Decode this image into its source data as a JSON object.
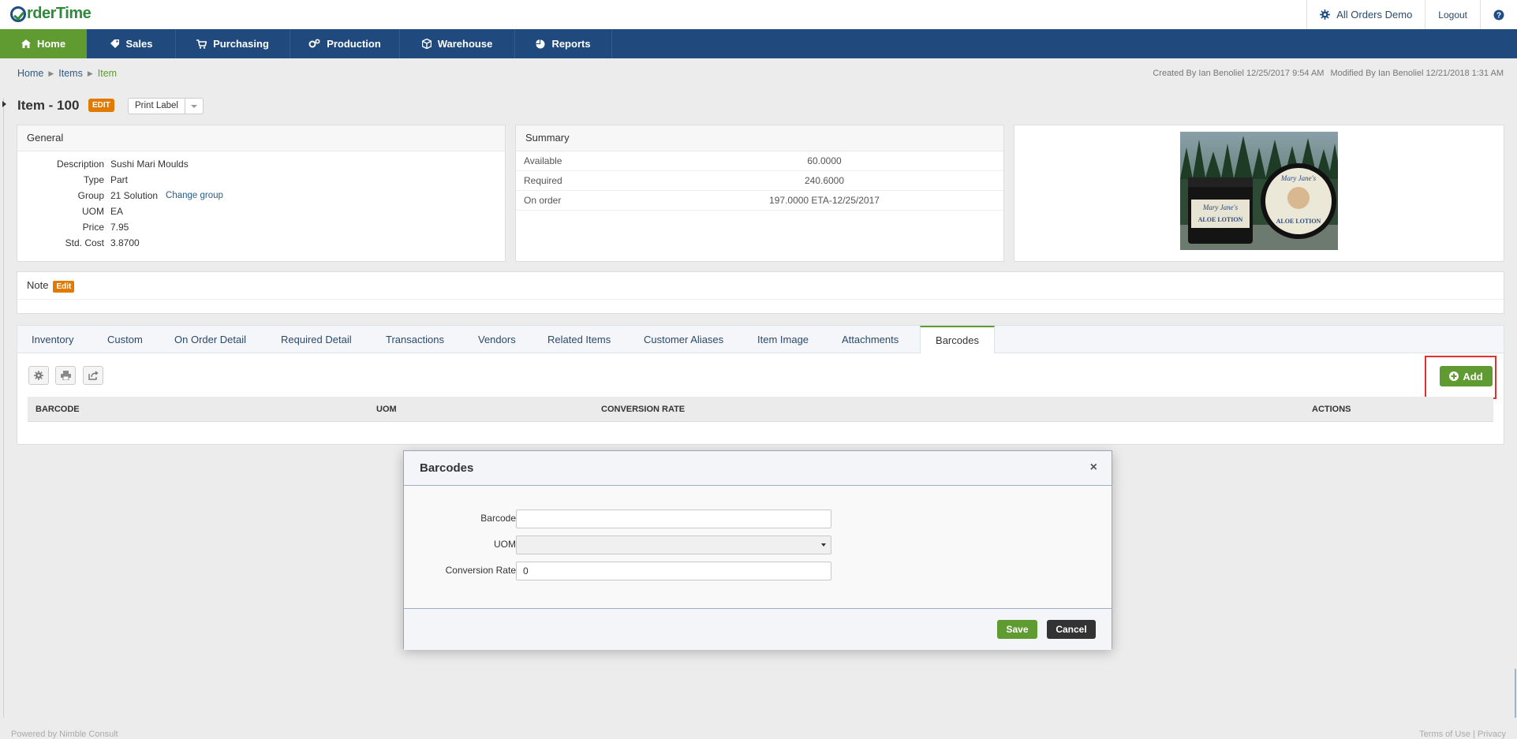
{
  "app": {
    "logo": "rderTime",
    "company": "All Orders Demo",
    "logout": "Logout",
    "help": "?"
  },
  "nav": [
    {
      "label": "Home",
      "icon": "home-icon"
    },
    {
      "label": "Sales",
      "icon": "tag-icon"
    },
    {
      "label": "Purchasing",
      "icon": "cart-icon"
    },
    {
      "label": "Production",
      "icon": "gears-icon"
    },
    {
      "label": "Warehouse",
      "icon": "cube-icon"
    },
    {
      "label": "Reports",
      "icon": "pie-chart-icon"
    }
  ],
  "breadcrumb": [
    "Home",
    "Items",
    "Item"
  ],
  "meta": {
    "created": "Created By Ian Benoliel 12/25/2017 9:54 AM",
    "modified": "Modified By Ian Benoliel 12/21/2018 1:31 AM"
  },
  "item": {
    "title": "Item - 100",
    "edit_badge": "EDIT",
    "print_label": "Print Label"
  },
  "general": {
    "heading": "General",
    "rows": [
      {
        "label": "Description",
        "value": "Sushi Mari Moulds"
      },
      {
        "label": "Type",
        "value": "Part"
      },
      {
        "label": "Group",
        "value": "21 Solution"
      },
      {
        "label": "UOM",
        "value": "EA"
      },
      {
        "label": "Price",
        "value": "7.95"
      },
      {
        "label": "Std. Cost",
        "value": "3.8700"
      }
    ],
    "change_group": "Change group"
  },
  "summary": {
    "heading": "Summary",
    "rows": [
      {
        "label": "Available",
        "value": "60.0000"
      },
      {
        "label": "Required",
        "value": "240.6000"
      },
      {
        "label": "On order",
        "value": "197.0000 ETA-12/25/2017"
      }
    ]
  },
  "image": {
    "label_left_brand": "Mary Jane's",
    "label_left_product": "ALOE LOTION",
    "label_right_brand": "Mary Jane's",
    "label_right_product": "ALOE LOTION"
  },
  "note": {
    "heading": "Note",
    "edit": "Edit"
  },
  "tabs": [
    "Inventory",
    "Custom",
    "On Order Detail",
    "Required Detail",
    "Transactions",
    "Vendors",
    "Related Items",
    "Customer Aliases",
    "Item Image",
    "Attachments",
    "Barcodes"
  ],
  "active_tab": "Barcodes",
  "grid": {
    "add": "Add",
    "columns": [
      "BARCODE",
      "UOM",
      "CONVERSION RATE",
      "ACTIONS"
    ]
  },
  "modal": {
    "title": "Barcodes",
    "close": "×",
    "fields": {
      "barcode_label": "Barcode",
      "barcode_value": "",
      "uom_label": "UOM",
      "uom_value": "",
      "rate_label": "Conversion Rate",
      "rate_value": "0"
    },
    "save": "Save",
    "cancel": "Cancel"
  },
  "footer": {
    "left": "Powered by Nimble Consult",
    "right": "Terms of Use  |  Privacy"
  },
  "colors": {
    "nav_bg": "#204a7d",
    "accent_green": "#5f9b31",
    "edit_orange": "#e07b00",
    "highlight_red": "#e03030"
  }
}
